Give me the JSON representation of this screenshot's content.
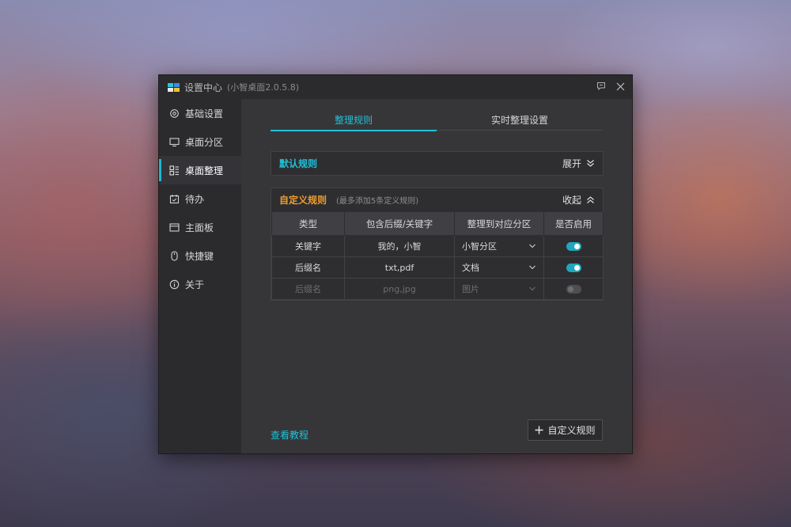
{
  "window": {
    "title": "设置中心",
    "version": "(小智桌面2.0.5.8)",
    "logo_colors": [
      "#2ec4d6",
      "#3a8fe0",
      "#e8e8e8",
      "#f0c030"
    ]
  },
  "sidebar": {
    "items": [
      {
        "label": "基础设置",
        "icon": "gear-icon",
        "active": false
      },
      {
        "label": "桌面分区",
        "icon": "monitor-icon",
        "active": false
      },
      {
        "label": "桌面整理",
        "icon": "layout-icon",
        "active": true
      },
      {
        "label": "待办",
        "icon": "calendar-check-icon",
        "active": false
      },
      {
        "label": "主面板",
        "icon": "panel-icon",
        "active": false
      },
      {
        "label": "快捷键",
        "icon": "mouse-icon",
        "active": false
      },
      {
        "label": "关于",
        "icon": "info-icon",
        "active": false
      }
    ]
  },
  "tabs": [
    {
      "label": "整理规则",
      "active": true
    },
    {
      "label": "实时整理设置",
      "active": false
    }
  ],
  "default_rule": {
    "title": "默认规则",
    "toggle_label": "展开"
  },
  "custom_rule": {
    "title": "自定义规则",
    "subtitle": "(最多添加5条定义规则)",
    "toggle_label": "收起",
    "columns": [
      "类型",
      "包含后缀/关键字",
      "整理到对应分区",
      "是否启用"
    ],
    "rows": [
      {
        "type": "关键字",
        "match": "我的，小智",
        "target": "小智分区",
        "enabled": true
      },
      {
        "type": "后缀名",
        "match": "txt,pdf",
        "target": "文档",
        "enabled": true
      },
      {
        "type": "后缀名",
        "match": "png,jpg",
        "target": "图片",
        "enabled": false
      }
    ]
  },
  "footer": {
    "tutorial_link": "查看教程",
    "add_button": "自定义规则"
  },
  "colors": {
    "accent": "#1fc1d9",
    "custom_title": "#ee9d2c"
  }
}
